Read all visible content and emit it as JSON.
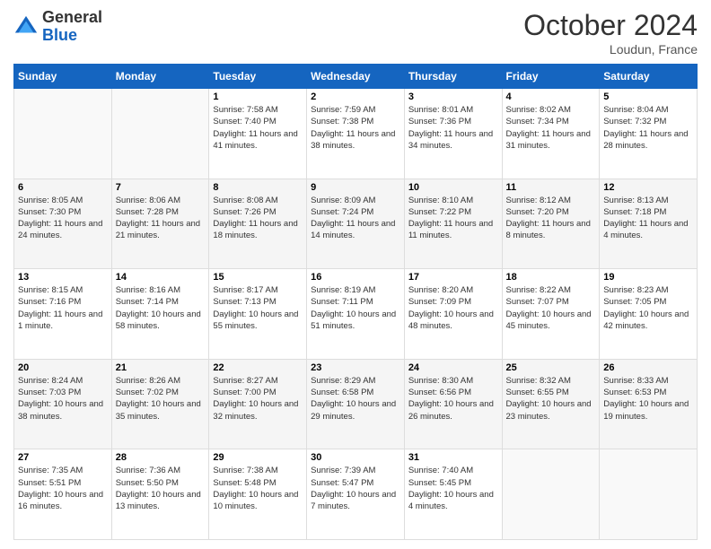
{
  "header": {
    "logo": {
      "line1": "General",
      "line2": "Blue"
    },
    "title": "October 2024",
    "location": "Loudun, France"
  },
  "days_of_week": [
    "Sunday",
    "Monday",
    "Tuesday",
    "Wednesday",
    "Thursday",
    "Friday",
    "Saturday"
  ],
  "weeks": [
    [
      {
        "day": "",
        "info": ""
      },
      {
        "day": "",
        "info": ""
      },
      {
        "day": "1",
        "sunrise": "Sunrise: 7:58 AM",
        "sunset": "Sunset: 7:40 PM",
        "daylight": "Daylight: 11 hours and 41 minutes."
      },
      {
        "day": "2",
        "sunrise": "Sunrise: 7:59 AM",
        "sunset": "Sunset: 7:38 PM",
        "daylight": "Daylight: 11 hours and 38 minutes."
      },
      {
        "day": "3",
        "sunrise": "Sunrise: 8:01 AM",
        "sunset": "Sunset: 7:36 PM",
        "daylight": "Daylight: 11 hours and 34 minutes."
      },
      {
        "day": "4",
        "sunrise": "Sunrise: 8:02 AM",
        "sunset": "Sunset: 7:34 PM",
        "daylight": "Daylight: 11 hours and 31 minutes."
      },
      {
        "day": "5",
        "sunrise": "Sunrise: 8:04 AM",
        "sunset": "Sunset: 7:32 PM",
        "daylight": "Daylight: 11 hours and 28 minutes."
      }
    ],
    [
      {
        "day": "6",
        "sunrise": "Sunrise: 8:05 AM",
        "sunset": "Sunset: 7:30 PM",
        "daylight": "Daylight: 11 hours and 24 minutes."
      },
      {
        "day": "7",
        "sunrise": "Sunrise: 8:06 AM",
        "sunset": "Sunset: 7:28 PM",
        "daylight": "Daylight: 11 hours and 21 minutes."
      },
      {
        "day": "8",
        "sunrise": "Sunrise: 8:08 AM",
        "sunset": "Sunset: 7:26 PM",
        "daylight": "Daylight: 11 hours and 18 minutes."
      },
      {
        "day": "9",
        "sunrise": "Sunrise: 8:09 AM",
        "sunset": "Sunset: 7:24 PM",
        "daylight": "Daylight: 11 hours and 14 minutes."
      },
      {
        "day": "10",
        "sunrise": "Sunrise: 8:10 AM",
        "sunset": "Sunset: 7:22 PM",
        "daylight": "Daylight: 11 hours and 11 minutes."
      },
      {
        "day": "11",
        "sunrise": "Sunrise: 8:12 AM",
        "sunset": "Sunset: 7:20 PM",
        "daylight": "Daylight: 11 hours and 8 minutes."
      },
      {
        "day": "12",
        "sunrise": "Sunrise: 8:13 AM",
        "sunset": "Sunset: 7:18 PM",
        "daylight": "Daylight: 11 hours and 4 minutes."
      }
    ],
    [
      {
        "day": "13",
        "sunrise": "Sunrise: 8:15 AM",
        "sunset": "Sunset: 7:16 PM",
        "daylight": "Daylight: 11 hours and 1 minute."
      },
      {
        "day": "14",
        "sunrise": "Sunrise: 8:16 AM",
        "sunset": "Sunset: 7:14 PM",
        "daylight": "Daylight: 10 hours and 58 minutes."
      },
      {
        "day": "15",
        "sunrise": "Sunrise: 8:17 AM",
        "sunset": "Sunset: 7:13 PM",
        "daylight": "Daylight: 10 hours and 55 minutes."
      },
      {
        "day": "16",
        "sunrise": "Sunrise: 8:19 AM",
        "sunset": "Sunset: 7:11 PM",
        "daylight": "Daylight: 10 hours and 51 minutes."
      },
      {
        "day": "17",
        "sunrise": "Sunrise: 8:20 AM",
        "sunset": "Sunset: 7:09 PM",
        "daylight": "Daylight: 10 hours and 48 minutes."
      },
      {
        "day": "18",
        "sunrise": "Sunrise: 8:22 AM",
        "sunset": "Sunset: 7:07 PM",
        "daylight": "Daylight: 10 hours and 45 minutes."
      },
      {
        "day": "19",
        "sunrise": "Sunrise: 8:23 AM",
        "sunset": "Sunset: 7:05 PM",
        "daylight": "Daylight: 10 hours and 42 minutes."
      }
    ],
    [
      {
        "day": "20",
        "sunrise": "Sunrise: 8:24 AM",
        "sunset": "Sunset: 7:03 PM",
        "daylight": "Daylight: 10 hours and 38 minutes."
      },
      {
        "day": "21",
        "sunrise": "Sunrise: 8:26 AM",
        "sunset": "Sunset: 7:02 PM",
        "daylight": "Daylight: 10 hours and 35 minutes."
      },
      {
        "day": "22",
        "sunrise": "Sunrise: 8:27 AM",
        "sunset": "Sunset: 7:00 PM",
        "daylight": "Daylight: 10 hours and 32 minutes."
      },
      {
        "day": "23",
        "sunrise": "Sunrise: 8:29 AM",
        "sunset": "Sunset: 6:58 PM",
        "daylight": "Daylight: 10 hours and 29 minutes."
      },
      {
        "day": "24",
        "sunrise": "Sunrise: 8:30 AM",
        "sunset": "Sunset: 6:56 PM",
        "daylight": "Daylight: 10 hours and 26 minutes."
      },
      {
        "day": "25",
        "sunrise": "Sunrise: 8:32 AM",
        "sunset": "Sunset: 6:55 PM",
        "daylight": "Daylight: 10 hours and 23 minutes."
      },
      {
        "day": "26",
        "sunrise": "Sunrise: 8:33 AM",
        "sunset": "Sunset: 6:53 PM",
        "daylight": "Daylight: 10 hours and 19 minutes."
      }
    ],
    [
      {
        "day": "27",
        "sunrise": "Sunrise: 7:35 AM",
        "sunset": "Sunset: 5:51 PM",
        "daylight": "Daylight: 10 hours and 16 minutes."
      },
      {
        "day": "28",
        "sunrise": "Sunrise: 7:36 AM",
        "sunset": "Sunset: 5:50 PM",
        "daylight": "Daylight: 10 hours and 13 minutes."
      },
      {
        "day": "29",
        "sunrise": "Sunrise: 7:38 AM",
        "sunset": "Sunset: 5:48 PM",
        "daylight": "Daylight: 10 hours and 10 minutes."
      },
      {
        "day": "30",
        "sunrise": "Sunrise: 7:39 AM",
        "sunset": "Sunset: 5:47 PM",
        "daylight": "Daylight: 10 hours and 7 minutes."
      },
      {
        "day": "31",
        "sunrise": "Sunrise: 7:40 AM",
        "sunset": "Sunset: 5:45 PM",
        "daylight": "Daylight: 10 hours and 4 minutes."
      },
      {
        "day": "",
        "info": ""
      },
      {
        "day": "",
        "info": ""
      }
    ]
  ]
}
